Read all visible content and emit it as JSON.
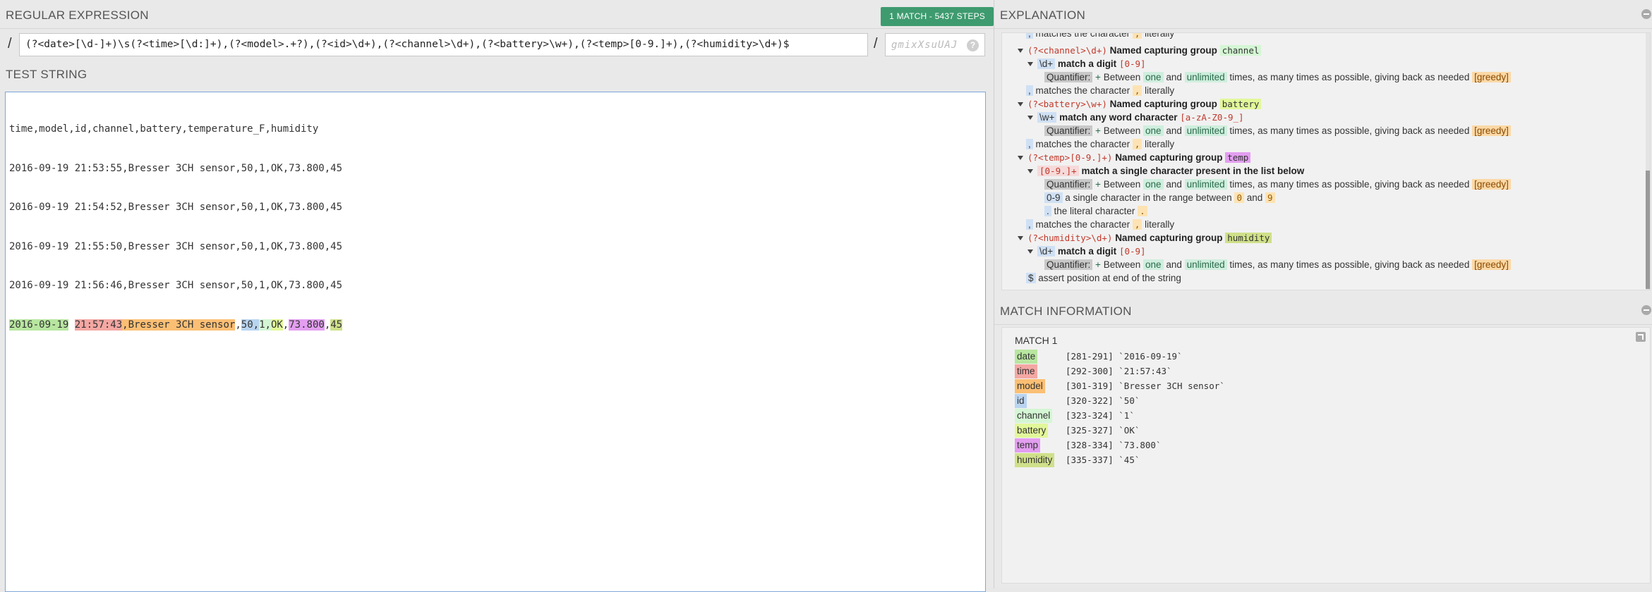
{
  "regex_panel": {
    "title": "REGULAR EXPRESSION",
    "match_badge": "1 MATCH - 5437 STEPS",
    "delimiter_open": "/",
    "delimiter_close": "/",
    "pattern": "(?<date>[\\d-]+)\\s(?<time>[\\d:]+),(?<model>.+?),(?<id>\\d+),(?<channel>\\d+),(?<battery>\\w+),(?<temp>[0-9.]+),(?<humidity>\\d+)$",
    "flags_placeholder": "gmixXsuUAJ",
    "flags_help": "?"
  },
  "test_string_panel": {
    "title": "TEST STRING",
    "lines": [
      "time,model,id,channel,battery,temperature_F,humidity",
      "2016-09-19 21:53:55,Bresser 3CH sensor,50,1,OK,73.800,45",
      "2016-09-19 21:54:52,Bresser 3CH sensor,50,1,OK,73.800,45",
      "2016-09-19 21:55:50,Bresser 3CH sensor,50,1,OK,73.800,45",
      "2016-09-19 21:56:46,Bresser 3CH sensor,50,1,OK,73.800,45"
    ],
    "matched_line": {
      "date": "2016-09-19",
      "sep1": " ",
      "time": "21:57:43",
      "model": "Bresser 3CH sensor",
      "id": "50",
      "channel": "1",
      "battery": "OK",
      "temp": "73.800",
      "humidity": "45",
      "comma": ","
    }
  },
  "explanation_panel": {
    "title": "EXPLANATION",
    "l1_tok": ",",
    "l1_text": "matches the character",
    "l1_lit": ",",
    "l1_end": "literally",
    "l2_tok": "(?<channel>\\d+)",
    "l2_text": "Named capturing group",
    "l2_grp": "channel",
    "l3_tok": "\\d+",
    "l3_text": "match a digit",
    "l3_cls": "[0-9]",
    "l4_q": "Quantifier:",
    "l4_plus": "+",
    "l4_a": "Between",
    "l4_one": "one",
    "l4_and": "and",
    "l4_unl": "unlimited",
    "l4_b": "times, as many times as possible, giving back as needed",
    "l4_greedy": "[greedy]",
    "l5_tok": ",",
    "l5_text": "matches the character",
    "l5_lit": ",",
    "l5_end": "literally",
    "l6_tok": "(?<battery>\\w+)",
    "l6_text": "Named capturing group",
    "l6_grp": "battery",
    "l7_tok": "\\w+",
    "l7_text": "match any word character",
    "l7_cls": "[a-zA-Z0-9_]",
    "l8_q": "Quantifier:",
    "l8_plus": "+",
    "l8_a": "Between",
    "l8_one": "one",
    "l8_and": "and",
    "l8_unl": "unlimited",
    "l8_b": "times, as many times as possible, giving back as needed",
    "l8_greedy": "[greedy]",
    "l9_tok": ",",
    "l9_text": "matches the character",
    "l9_lit": ",",
    "l9_end": "literally",
    "l10_tok": "(?<temp>[0-9.]+)",
    "l10_text": "Named capturing group",
    "l10_grp": "temp",
    "l11_tok": "[0-9.]+",
    "l11_text": "match a single character present in the list below",
    "l12_q": "Quantifier:",
    "l12_plus": "+",
    "l12_a": "Between",
    "l12_one": "one",
    "l12_and": "and",
    "l12_unl": "unlimited",
    "l12_b": "times, as many times as possible, giving back as needed",
    "l12_greedy": "[greedy]",
    "l13_tok": "0-9",
    "l13_text": "a single character in the range between",
    "l13_a": "0",
    "l13_and": "and",
    "l13_b": "9",
    "l14_tok": ".",
    "l14_text": "the literal character",
    "l14_lit": ".",
    "l15_tok": ",",
    "l15_text": "matches the character",
    "l15_lit": ",",
    "l15_end": "literally",
    "l16_tok": "(?<humidity>\\d+)",
    "l16_text": "Named capturing group",
    "l16_grp": "humidity",
    "l17_tok": "\\d+",
    "l17_text": "match a digit",
    "l17_cls": "[0-9]",
    "l18_q": "Quantifier:",
    "l18_plus": "+",
    "l18_a": "Between",
    "l18_one": "one",
    "l18_and": "and",
    "l18_unl": "unlimited",
    "l18_b": "times, as many times as possible, giving back as needed",
    "l18_greedy": "[greedy]",
    "l19_tok": "$",
    "l19_text": "assert position at end of the string"
  },
  "match_info_panel": {
    "title": "MATCH INFORMATION",
    "match_label": "MATCH 1",
    "groups": [
      {
        "name": "date",
        "range": "[281-291]",
        "value": "`2016-09-19`"
      },
      {
        "name": "time",
        "range": "[292-300]",
        "value": "`21:57:43`"
      },
      {
        "name": "model",
        "range": "[301-319]",
        "value": "`Bresser 3CH sensor`"
      },
      {
        "name": "id",
        "range": "[320-322]",
        "value": "`50`"
      },
      {
        "name": "channel",
        "range": "[323-324]",
        "value": "`1`"
      },
      {
        "name": "battery",
        "range": "[325-327]",
        "value": "`OK`"
      },
      {
        "name": "temp",
        "range": "[328-334]",
        "value": "`73.800`"
      },
      {
        "name": "humidity",
        "range": "[335-337]",
        "value": "`45`"
      }
    ]
  },
  "colors": {
    "badge": "#3e9b6f",
    "date": "#b8e6a0",
    "time": "#f4a7a3",
    "model": "#fbbf74",
    "id": "#b9d4f0",
    "channel": "#d4f6d4",
    "battery": "#e2f79a",
    "temp": "#e39ef0",
    "humidity": "#cfe08a"
  },
  "icons": [
    "collapse-icon",
    "expand-icon",
    "help-icon",
    "tree-toggle-icon"
  ]
}
